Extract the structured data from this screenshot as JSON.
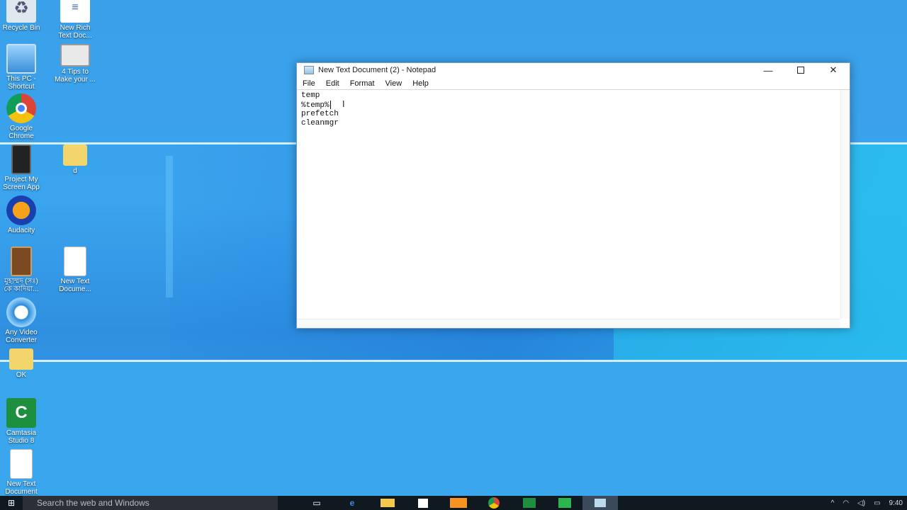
{
  "desktop_icons": [
    {
      "label": "Recycle Bin",
      "icon": "recycle-bin-icon"
    },
    {
      "label": "New Rich\nText Doc...",
      "icon": "document-icon"
    },
    {
      "label": "This PC -\nShortcut",
      "icon": "computer-icon"
    },
    {
      "label": "4 Tips to\nMake your ...",
      "icon": "video-thumbnail-icon"
    },
    {
      "label": "Google\nChrome",
      "icon": "chrome-icon"
    },
    {
      "label": "Project My\nScreen App",
      "icon": "phone-icon"
    },
    {
      "label": "d",
      "icon": "folder-icon"
    },
    {
      "label": "Audacity",
      "icon": "headphones-icon"
    },
    {
      "label": "মুহাম্মদ (সঃ)\nকে কাদিয়া...",
      "icon": "book-icon"
    },
    {
      "label": "New Text\nDocume...",
      "icon": "text-file-icon"
    },
    {
      "label": "Any Video\nConverter",
      "icon": "converter-icon"
    },
    {
      "label": "OK",
      "icon": "folder-icon"
    },
    {
      "label": "Camtasia\nStudio 8",
      "icon": "camtasia-icon"
    },
    {
      "label": "New Text\nDocument",
      "icon": "text-file-icon"
    }
  ],
  "notepad": {
    "title": "New Text Document (2) - Notepad",
    "menu": [
      "File",
      "Edit",
      "Format",
      "View",
      "Help"
    ],
    "lines": [
      "temp",
      "%temp%",
      "prefetch",
      "cleanmgr"
    ]
  },
  "taskbar": {
    "search_placeholder": "Search the web and Windows",
    "clock": "9:40"
  }
}
